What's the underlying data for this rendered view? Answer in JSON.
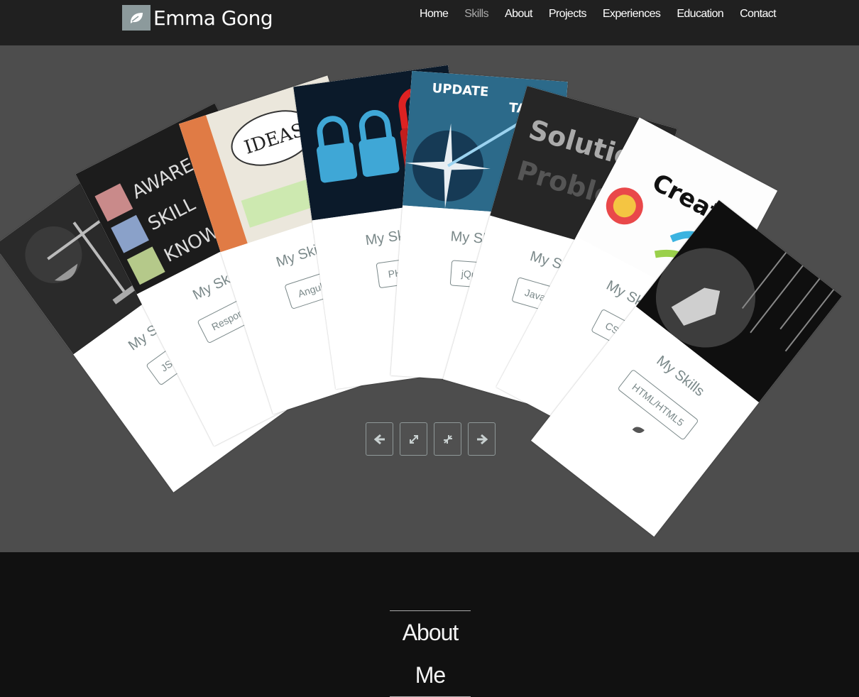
{
  "brand": {
    "name": "Emma Gong",
    "logo_icon": "leaf-icon"
  },
  "nav": {
    "items": [
      {
        "label": "Home",
        "active": false
      },
      {
        "label": "Skills",
        "active": true
      },
      {
        "label": "About",
        "active": false
      },
      {
        "label": "Projects",
        "active": false
      },
      {
        "label": "Experiences",
        "active": false
      },
      {
        "label": "Education",
        "active": false
      },
      {
        "label": "Contact",
        "active": false
      }
    ]
  },
  "skills": {
    "cards": [
      {
        "title": "My Skills",
        "button": "JScript",
        "image": "scales-chalkboard-image"
      },
      {
        "title": "My Skills",
        "button": "Responsive",
        "image": "ask-chalkboard-image"
      },
      {
        "title": "My Skills",
        "button": "Angular",
        "image": "ideas-checklist-image"
      },
      {
        "title": "My Skills",
        "button": "PHP",
        "image": "padlocks-image"
      },
      {
        "title": "My Skills",
        "button": "jQuery",
        "image": "compass-update-image"
      },
      {
        "title": "My Skills",
        "button": "JavaScript",
        "image": "solution-problem-image"
      },
      {
        "title": "My Skills",
        "button": "CSS",
        "image": "creative-image"
      },
      {
        "title": "My Skills",
        "button": "HTML/HTML5",
        "image": "hand-keys-image"
      }
    ],
    "controls": [
      {
        "name": "prev-button",
        "icon": "arrow-left-icon"
      },
      {
        "name": "expand-button",
        "icon": "expand-icon"
      },
      {
        "name": "collapse-button",
        "icon": "compress-icon"
      },
      {
        "name": "next-button",
        "icon": "arrow-right-icon"
      }
    ]
  },
  "about": {
    "title": "About Me"
  },
  "colors": {
    "nav_bg": "#202020",
    "skills_bg": "#4d4d4d",
    "footer_bg": "#111111",
    "accent": "#7a8889"
  }
}
